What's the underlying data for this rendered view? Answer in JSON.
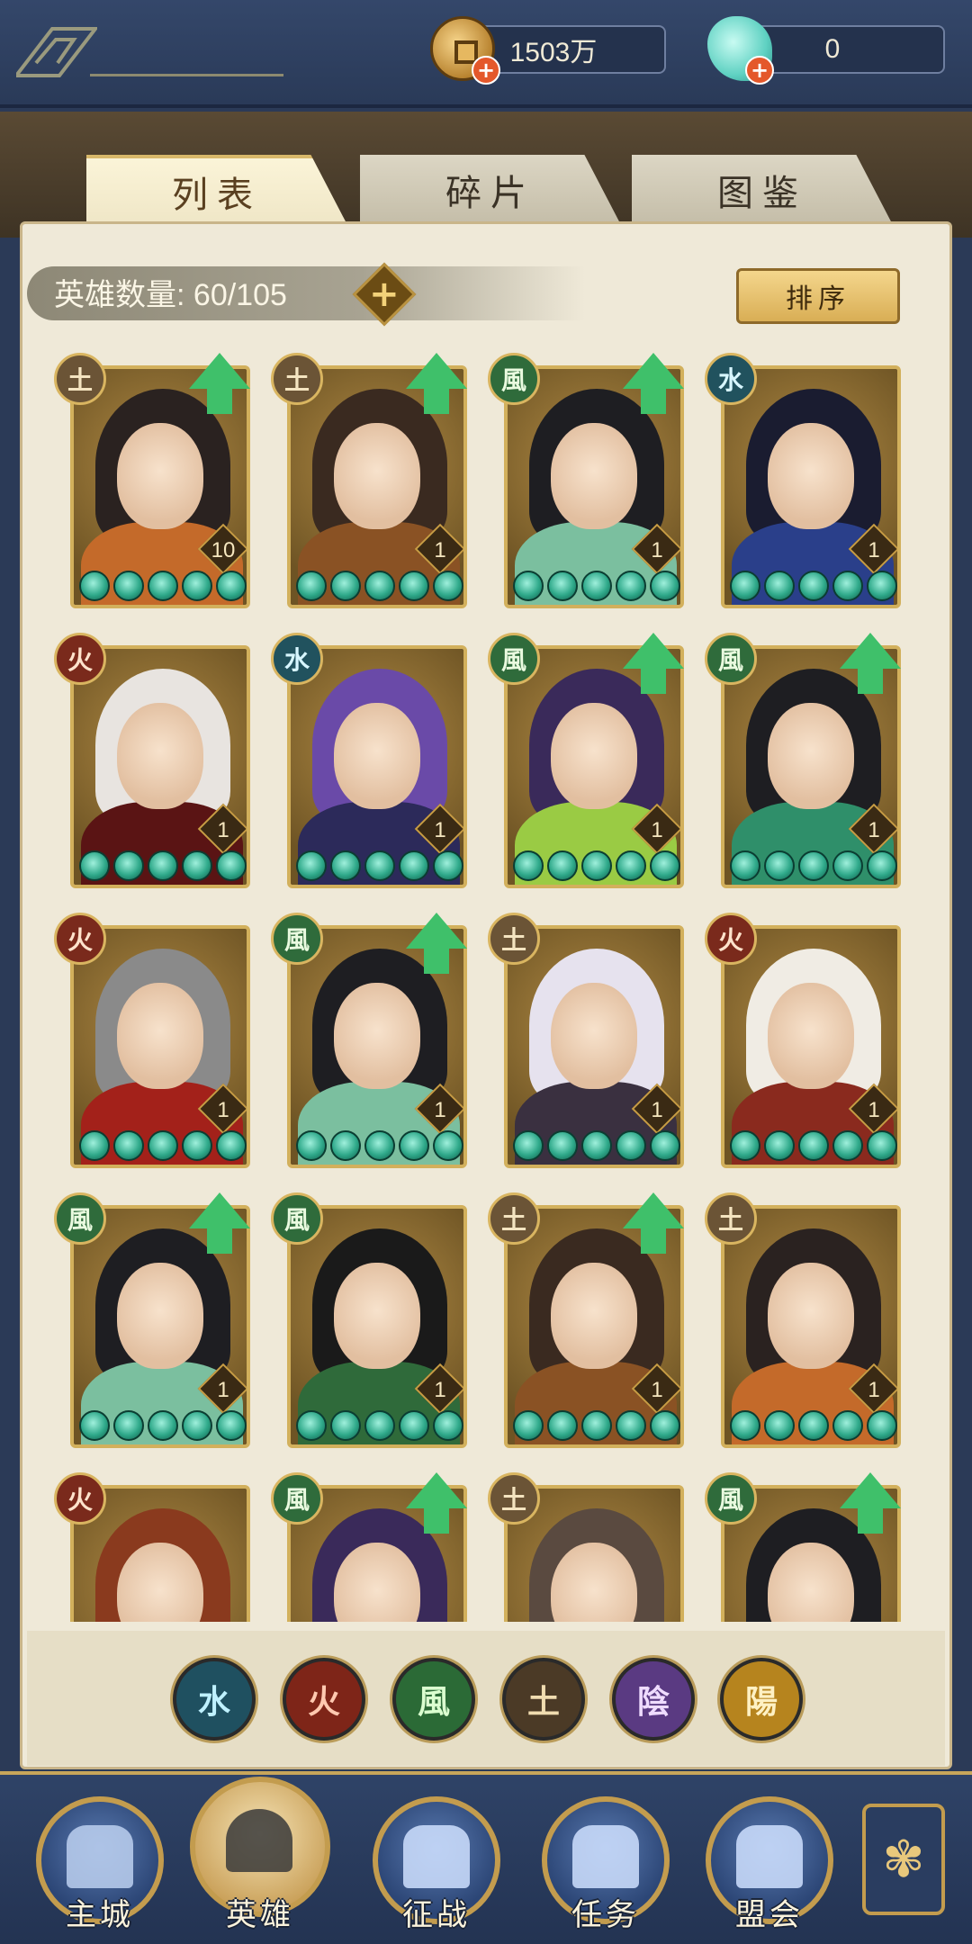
{
  "currency": {
    "coins": "1503万",
    "jade": "0"
  },
  "tabs": [
    {
      "label": "列表",
      "active": true
    },
    {
      "label": "碎片",
      "active": false
    },
    {
      "label": "图鉴",
      "active": false
    }
  ],
  "hero_count": {
    "label": "英雄数量:",
    "value": "60/105"
  },
  "sort_label": "排序",
  "heroes": [
    {
      "element": "earth",
      "element_glyph": "土",
      "level": "10",
      "upgrade": true,
      "hair": "#2a2220",
      "outfit": "#c46a2a"
    },
    {
      "element": "earth",
      "element_glyph": "土",
      "level": "1",
      "upgrade": true,
      "hair": "#3a2a20",
      "outfit": "#8a5224"
    },
    {
      "element": "wind",
      "element_glyph": "風",
      "level": "1",
      "upgrade": true,
      "hair": "#1e1e22",
      "outfit": "#7bbf9f"
    },
    {
      "element": "water",
      "element_glyph": "水",
      "level": "1",
      "upgrade": false,
      "hair": "#1a1c30",
      "outfit": "#2a3f8a"
    },
    {
      "element": "fire",
      "element_glyph": "火",
      "level": "1",
      "upgrade": false,
      "hair": "#e8e4e0",
      "outfit": "#5a1414"
    },
    {
      "element": "water",
      "element_glyph": "水",
      "level": "1",
      "upgrade": false,
      "hair": "#6a4aa8",
      "outfit": "#2c2a5a"
    },
    {
      "element": "wind",
      "element_glyph": "風",
      "level": "1",
      "upgrade": true,
      "hair": "#3a2a5a",
      "outfit": "#9acb44"
    },
    {
      "element": "wind",
      "element_glyph": "風",
      "level": "1",
      "upgrade": true,
      "hair": "#1e1e22",
      "outfit": "#2f8f6a"
    },
    {
      "element": "fire",
      "element_glyph": "火",
      "level": "1",
      "upgrade": false,
      "hair": "#8a8a8a",
      "outfit": "#a3211a"
    },
    {
      "element": "wind",
      "element_glyph": "風",
      "level": "1",
      "upgrade": true,
      "hair": "#1e1e22",
      "outfit": "#7bbf9f"
    },
    {
      "element": "earth",
      "element_glyph": "土",
      "level": "1",
      "upgrade": false,
      "hair": "#e6e2ee",
      "outfit": "#3a3040"
    },
    {
      "element": "fire",
      "element_glyph": "火",
      "level": "1",
      "upgrade": false,
      "hair": "#f0ece4",
      "outfit": "#8a2a1e"
    },
    {
      "element": "wind",
      "element_glyph": "風",
      "level": "1",
      "upgrade": true,
      "hair": "#1e1e22",
      "outfit": "#7bbf9f"
    },
    {
      "element": "wind",
      "element_glyph": "風",
      "level": "1",
      "upgrade": false,
      "hair": "#1a1a1a",
      "outfit": "#2f6a3a"
    },
    {
      "element": "earth",
      "element_glyph": "土",
      "level": "1",
      "upgrade": true,
      "hair": "#3a2a20",
      "outfit": "#8a5224"
    },
    {
      "element": "earth",
      "element_glyph": "土",
      "level": "1",
      "upgrade": false,
      "hair": "#2a2220",
      "outfit": "#c46a2a"
    },
    {
      "element": "fire",
      "element_glyph": "火",
      "level": "",
      "upgrade": false,
      "hair": "#8a3a1e",
      "outfit": "#4a2a3a"
    },
    {
      "element": "wind",
      "element_glyph": "風",
      "level": "",
      "upgrade": true,
      "hair": "#3a2a5a",
      "outfit": "#9acb44"
    },
    {
      "element": "earth",
      "element_glyph": "土",
      "level": "",
      "upgrade": false,
      "hair": "#5a4a40",
      "outfit": "#7a6a5a"
    },
    {
      "element": "wind",
      "element_glyph": "風",
      "level": "",
      "upgrade": true,
      "hair": "#1e1e22",
      "outfit": "#2f8f6a"
    }
  ],
  "element_filters": [
    {
      "element": "water",
      "glyph": "水"
    },
    {
      "element": "fire",
      "glyph": "火"
    },
    {
      "element": "wind",
      "glyph": "風"
    },
    {
      "element": "earth",
      "glyph": "土"
    },
    {
      "element": "yin",
      "glyph": "陰"
    },
    {
      "element": "yang",
      "glyph": "陽"
    }
  ],
  "nav": [
    {
      "label": "主城",
      "icon": "city-gate-icon",
      "active": false
    },
    {
      "label": "英雄",
      "icon": "hero-portrait-icon",
      "active": true
    },
    {
      "label": "征战",
      "icon": "battle-icon",
      "active": false
    },
    {
      "label": "任务",
      "icon": "scroll-icon",
      "active": false
    },
    {
      "label": "盟会",
      "icon": "pavilion-icon",
      "active": false
    }
  ],
  "more_icon": "flower-knot-icon"
}
